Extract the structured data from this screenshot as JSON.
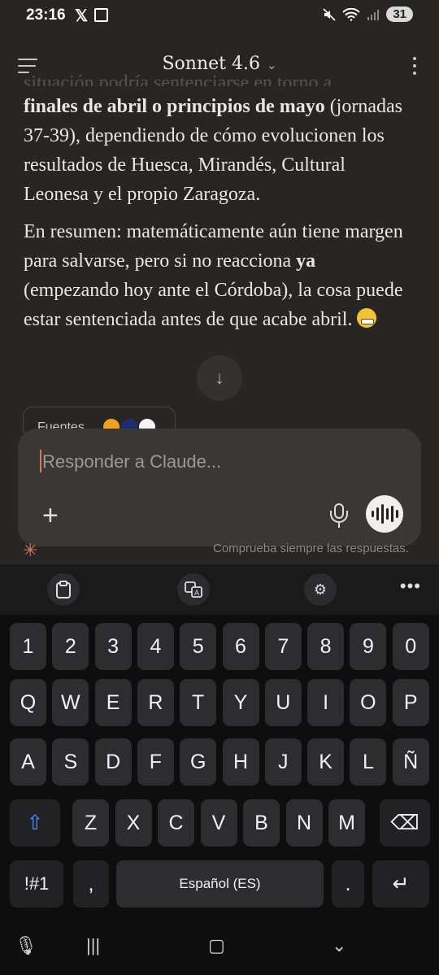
{
  "status": {
    "time": "23:16",
    "battery": "31"
  },
  "header": {
    "model": "Sonnet 4.6"
  },
  "content": {
    "cut_line": "situación podría sentenciarse en torno a",
    "p1_bold": "finales de abril o principios de mayo",
    "p1_rest": " (jornadas 37-39), dependiendo de cómo evolucionen los resultados de Huesca, Mirandés, Cultural Leonesa y el propio Zaragoza.",
    "p2_a": "En resumen: matemáticamente aún tiene margen para salvarse, pero si no reacciona ",
    "p2_bold": "ya",
    "p2_b": " (empezando hoy ante el Córdoba), la cosa puede estar sentenciada antes de que acabe abril. "
  },
  "sources": {
    "label": "Fuentes"
  },
  "input": {
    "placeholder": "Responder a Claude..."
  },
  "footer_note": "Comprueba siempre las respuestas.",
  "keyboard": {
    "row_numbers": [
      "1",
      "2",
      "3",
      "4",
      "5",
      "6",
      "7",
      "8",
      "9",
      "0"
    ],
    "row1": [
      "Q",
      "W",
      "E",
      "R",
      "T",
      "Y",
      "U",
      "I",
      "O",
      "P"
    ],
    "row2": [
      "A",
      "S",
      "D",
      "F",
      "G",
      "H",
      "J",
      "K",
      "L",
      "Ñ"
    ],
    "row3": [
      "Z",
      "X",
      "C",
      "V",
      "B",
      "N",
      "M"
    ],
    "symbols_label": "!#1",
    "comma": ",",
    "space_label": "Español (ES)",
    "period": "."
  }
}
